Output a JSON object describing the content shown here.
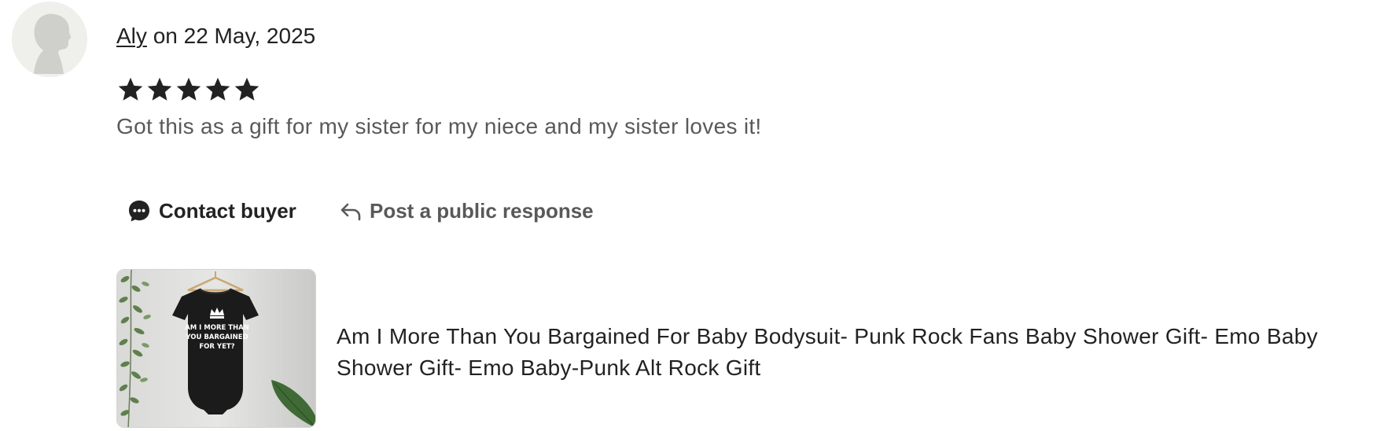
{
  "review": {
    "reviewer_name": "Aly",
    "date_prefix": "on",
    "date": "22 May, 2025",
    "rating": 5,
    "rating_max": 5,
    "text": "Got this as a gift for my sister for my niece and my sister loves it!"
  },
  "actions": {
    "contact_label": "Contact buyer",
    "respond_label": "Post a public response"
  },
  "listing": {
    "title": "Am I More Than You Bargained For Baby Bodysuit- Punk Rock Fans Baby Shower Gift- Emo Baby Shower Gift- Emo Baby-Punk Alt Rock Gift",
    "image_text_line1": "AM I MORE THAN",
    "image_text_line2": "YOU BARGAINED",
    "image_text_line3": "FOR YET?"
  },
  "icons": {
    "avatar": "default-avatar-icon",
    "star": "star-icon",
    "contact": "chat-bubble-icon",
    "respond": "reply-arrow-icon"
  },
  "colors": {
    "text_primary": "#222222",
    "text_secondary": "#595959",
    "star": "#222222",
    "avatar_bg": "#efefec",
    "avatar_silhouette": "#cfcfcb"
  }
}
